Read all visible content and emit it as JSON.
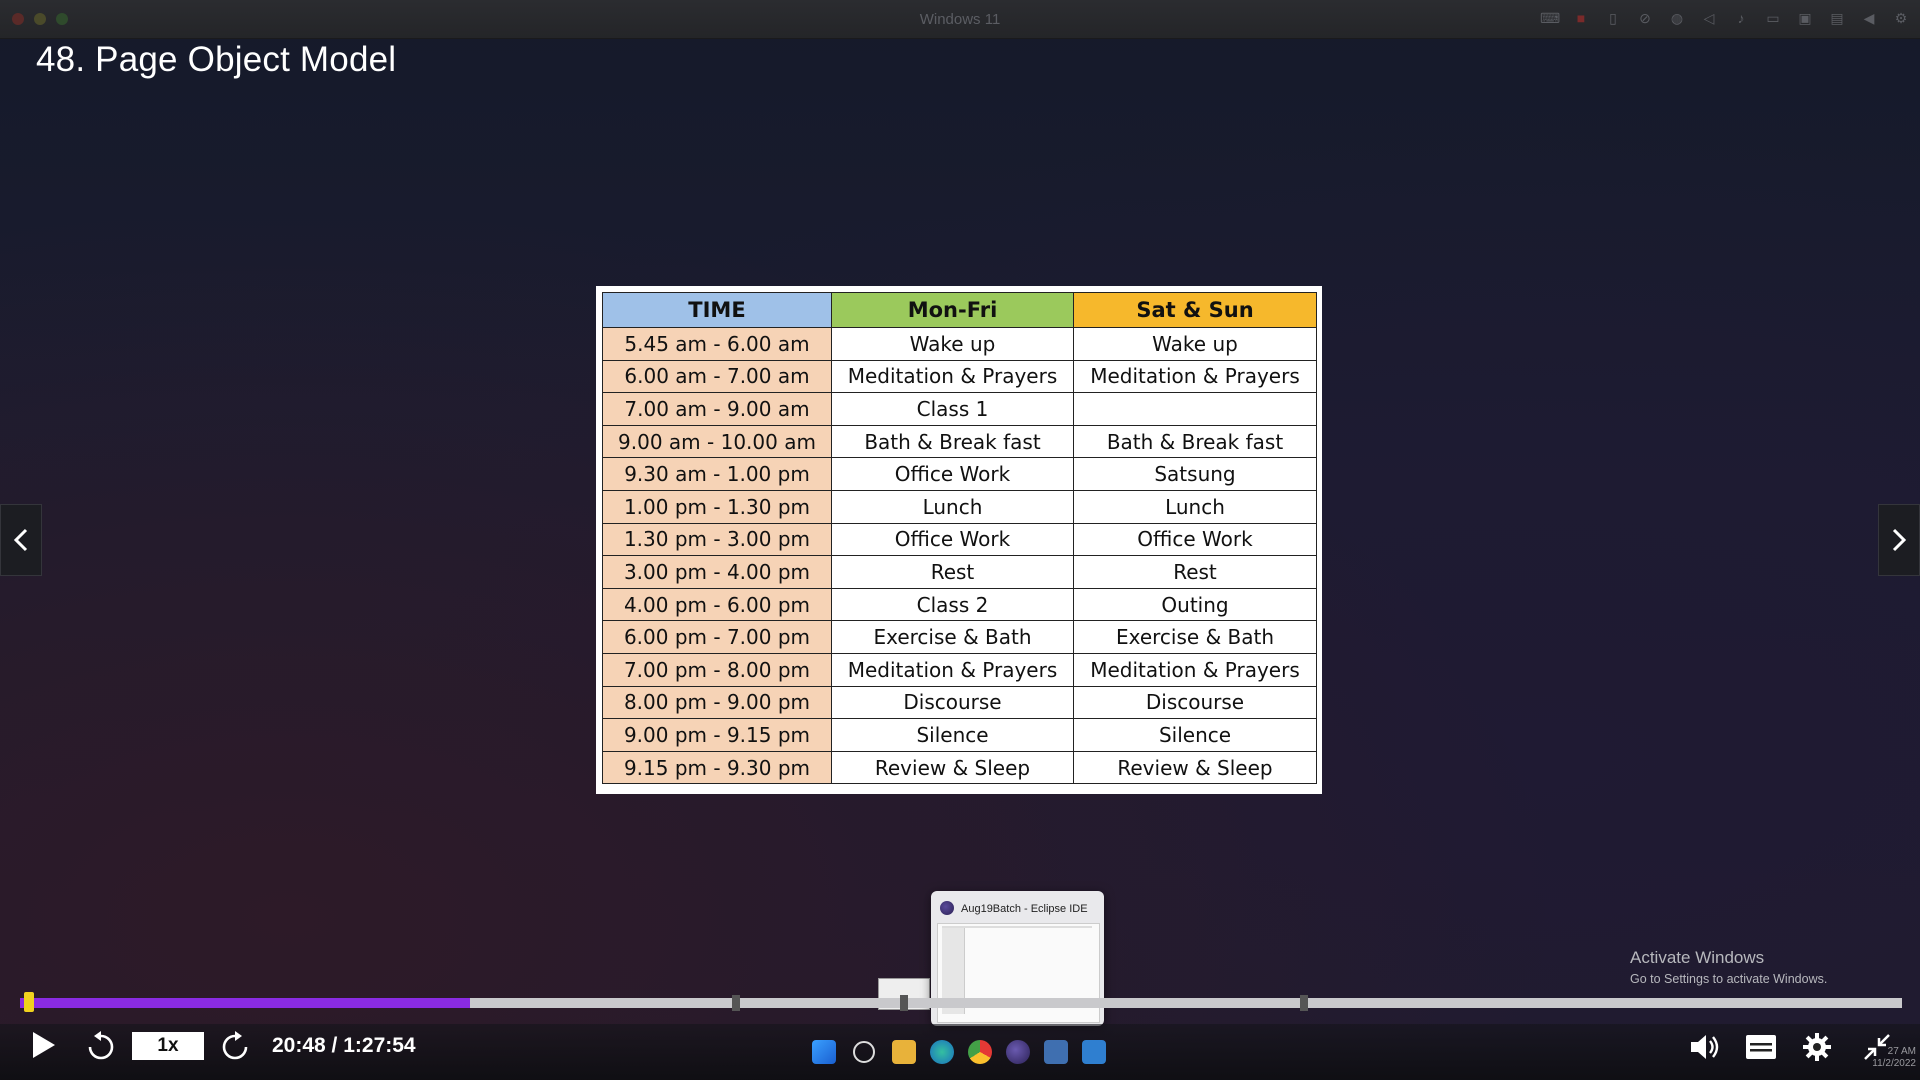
{
  "vm": {
    "title": "Windows 11",
    "icons": [
      "keyboard-icon",
      "record-icon",
      "usb-icon",
      "camera-off-icon",
      "globe-icon",
      "speaker-icon",
      "microphone-icon",
      "printer-icon",
      "video-icon",
      "folder-icon",
      "back-icon",
      "gear-icon"
    ]
  },
  "lecture": {
    "title": "48. Page Object Model"
  },
  "schedule": {
    "headers": [
      "TIME",
      "Mon-Fri",
      "Sat & Sun"
    ],
    "header_colors": [
      "#9fc1e8",
      "#9bc95c",
      "#f6b82c"
    ],
    "rows": [
      [
        "5.45 am - 6.00 am",
        "Wake up",
        "Wake up"
      ],
      [
        "6.00 am - 7.00 am",
        "Meditation & Prayers",
        "Meditation & Prayers"
      ],
      [
        "7.00 am - 9.00 am",
        "Class 1",
        ""
      ],
      [
        "9.00 am - 10.00 am",
        "Bath & Break fast",
        "Bath & Break fast"
      ],
      [
        "9.30 am - 1.00 pm",
        "Office Work",
        "Satsung"
      ],
      [
        "1.00 pm - 1.30 pm",
        "Lunch",
        "Lunch"
      ],
      [
        "1.30 pm - 3.00 pm",
        "Office Work",
        "Office Work"
      ],
      [
        "3.00 pm - 4.00 pm",
        "Rest",
        "Rest"
      ],
      [
        "4.00 pm - 6.00 pm",
        "Class 2",
        "Outing"
      ],
      [
        "6.00 pm - 7.00 pm",
        "Exercise & Bath",
        "Exercise & Bath"
      ],
      [
        "7.00 pm - 8.00 pm",
        "Meditation & Prayers",
        "Meditation & Prayers"
      ],
      [
        "8.00 pm - 9.00 pm",
        "Discourse",
        "Discourse"
      ],
      [
        "9.00 pm - 9.15 pm",
        "Silence",
        "Silence"
      ],
      [
        "9.15 pm - 9.30 pm",
        "Review & Sleep",
        "Review & Sleep"
      ]
    ]
  },
  "preview": {
    "title": "Aug19Batch - Eclipse IDE"
  },
  "activation": {
    "line1": "Activate Windows",
    "line2": "Go to Settings to activate Windows."
  },
  "player": {
    "speed": "1x",
    "time": "20:48 / 1:27:54",
    "progress_fraction": 0.239,
    "colors": {
      "played": "#8a2be2",
      "handle": "#f0d21e",
      "track": "#c9c9cc"
    }
  },
  "taskbar": {
    "icons": [
      "windows-start-icon",
      "search-icon",
      "file-explorer-icon",
      "edge-icon",
      "chrome-icon",
      "eclipse-icon",
      "notepad-icon",
      "app-icon"
    ]
  },
  "tray": {
    "time": "27 AM",
    "date": "11/2/2022"
  }
}
